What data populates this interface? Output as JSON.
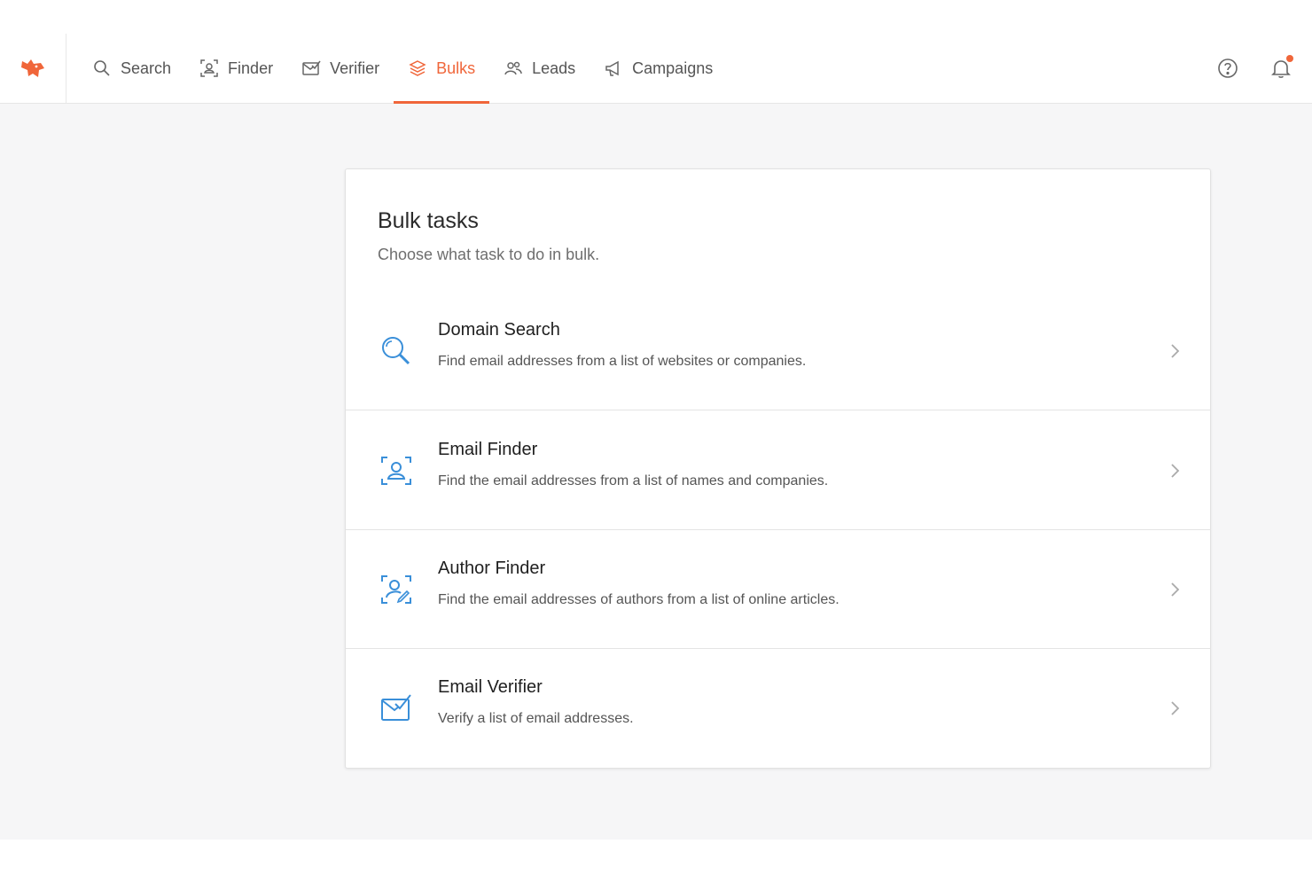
{
  "nav": {
    "items": [
      {
        "label": "Search",
        "icon": "search-icon"
      },
      {
        "label": "Finder",
        "icon": "finder-icon"
      },
      {
        "label": "Verifier",
        "icon": "verifier-icon"
      },
      {
        "label": "Bulks",
        "icon": "bulks-icon",
        "active": true
      },
      {
        "label": "Leads",
        "icon": "leads-icon"
      },
      {
        "label": "Campaigns",
        "icon": "campaigns-icon"
      }
    ],
    "accent_color": "#f0663a"
  },
  "header_icons": [
    "help-icon",
    "bell-icon"
  ],
  "page": {
    "title": "Bulk tasks",
    "subtitle": "Choose what task to do in bulk."
  },
  "tasks": [
    {
      "title": "Domain Search",
      "description": "Find email addresses from a list of websites or companies.",
      "icon": "domain-search-icon"
    },
    {
      "title": "Email Finder",
      "description": "Find the email addresses from a list of names and companies.",
      "icon": "email-finder-icon"
    },
    {
      "title": "Author Finder",
      "description": "Find the email addresses of authors from a list of online articles.",
      "icon": "author-finder-icon"
    },
    {
      "title": "Email Verifier",
      "description": "Verify a list of email addresses.",
      "icon": "email-verifier-icon"
    }
  ],
  "icon_color": "#3a8fd9"
}
